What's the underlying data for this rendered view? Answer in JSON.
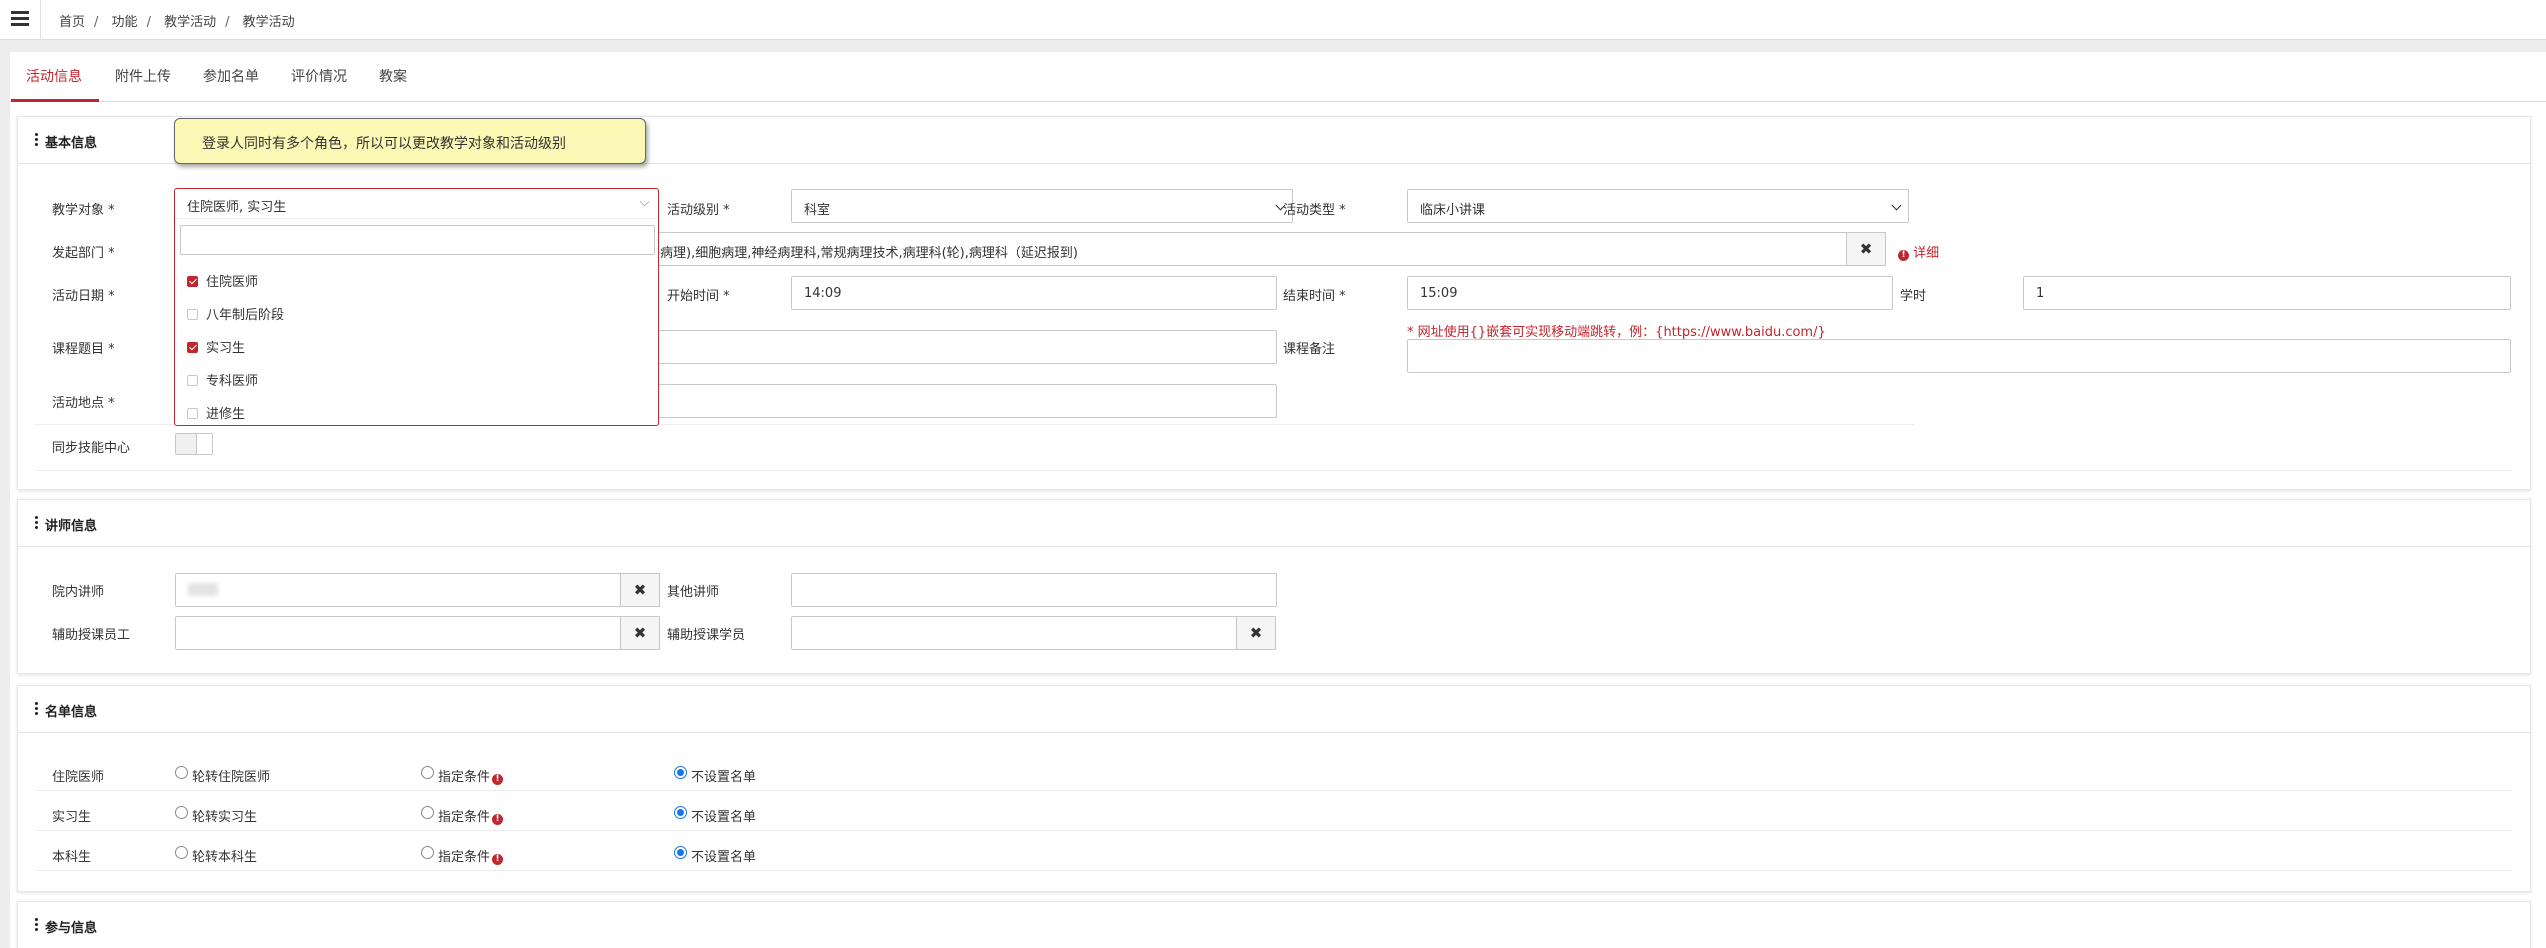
{
  "breadcrumb": [
    "首页",
    "功能",
    "教学活动",
    "教学活动"
  ],
  "tabs": [
    {
      "label": "活动信息",
      "active": true
    },
    {
      "label": "附件上传"
    },
    {
      "label": "参加名单"
    },
    {
      "label": "评价情况"
    },
    {
      "label": "教案"
    }
  ],
  "tooltip": "登录人同时有多个角色，所以可以更改教学对象和活动级别",
  "basic": {
    "title": "基本信息",
    "teach_target_label": "教学对象 *",
    "teach_target_value": "住院医师, 实习生",
    "teach_target_options": [
      {
        "label": "住院医师",
        "checked": true
      },
      {
        "label": "八年制后阶段",
        "checked": false
      },
      {
        "label": "实习生",
        "checked": true
      },
      {
        "label": "专科医师",
        "checked": false
      },
      {
        "label": "进修生",
        "checked": false
      }
    ],
    "level_label": "活动级别 *",
    "level_value": "科室",
    "type_label": "活动类型 *",
    "type_value": "临床小讲课",
    "dept_label": "发起部门 *",
    "dept_value": "子病理),细胞病理,神经病理科,常规病理技术,病理科(轮),病理科（延迟报到)",
    "detail_link": "详细",
    "date_label": "活动日期 *",
    "start_label": "开始时间 *",
    "start_value": "14:09",
    "end_label": "结束时间 *",
    "end_value": "15:09",
    "hours_label": "学时",
    "hours_value": "1",
    "course_label": "课程题目 *",
    "remark_hint": "* 网址使用{}嵌套可实现移动端跳转，例：{https://www.baidu.com/}",
    "remark_label": "课程备注",
    "place_label": "活动地点 *",
    "sync_label": "同步技能中心"
  },
  "lecturer": {
    "title": "讲师信息",
    "internal_label": "院内讲师",
    "other_label": "其他讲师",
    "assist_staff_label": "辅助授课员工",
    "assist_student_label": "辅助授课学员"
  },
  "roster": {
    "title": "名单信息",
    "rows": [
      {
        "label": "住院医师",
        "opt1": "轮转住院医师",
        "opt2": "指定条件",
        "opt3": "不设置名单",
        "selected": 3
      },
      {
        "label": "实习生",
        "opt1": "轮转实习生",
        "opt2": "指定条件",
        "opt3": "不设置名单",
        "selected": 3
      },
      {
        "label": "本科生",
        "opt1": "轮转本科生",
        "opt2": "指定条件",
        "opt3": "不设置名单",
        "selected": 3
      }
    ]
  },
  "participation": {
    "title": "参与信息"
  },
  "icons": {
    "menu": "hamburger-icon",
    "clear": "times-icon",
    "info": "exclamation-circle-icon",
    "section": "ellipsis-vertical-icon"
  },
  "colors": {
    "accent": "#c0262d",
    "tooltip_bg": "#fbf7b4",
    "radio_selected": "#1a73e8"
  }
}
